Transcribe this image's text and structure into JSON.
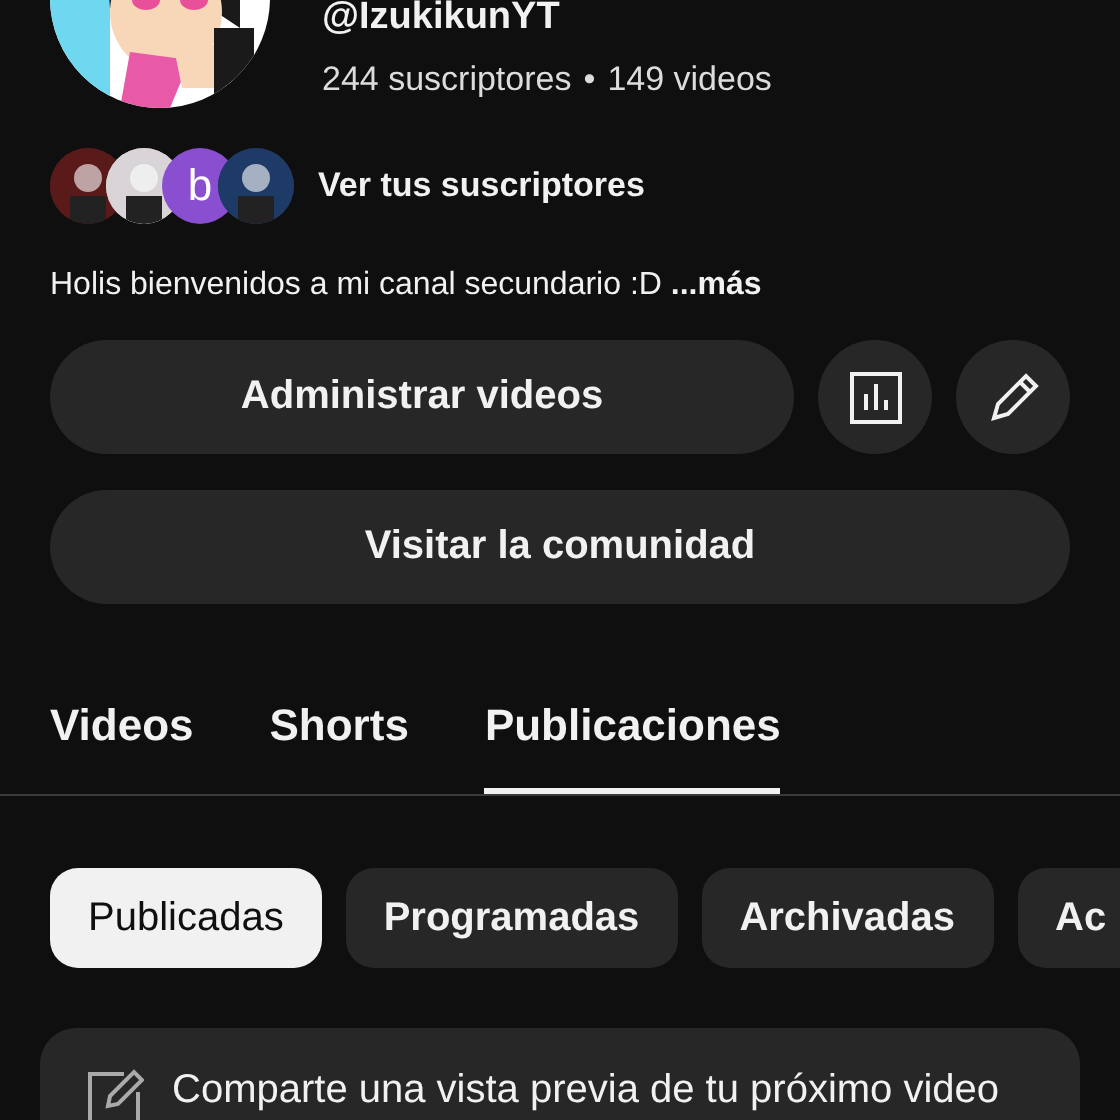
{
  "channel": {
    "handle": "@IzukikunYT",
    "stats": [
      "244 suscriptores",
      "149 videos"
    ],
    "separator": "•",
    "avatar": {
      "kind": "picture"
    }
  },
  "subscribers": {
    "avatars": [
      {
        "kind": "picture",
        "color": "#5a1a1a"
      },
      {
        "kind": "picture",
        "color": "#d8d4d8"
      },
      {
        "kind": "letter",
        "letter": "b",
        "color": "#8a4fd0"
      },
      {
        "kind": "picture",
        "color": "#1e3a66"
      }
    ],
    "link": "Ver tus suscriptores"
  },
  "description": {
    "text": "Holis bienvenidos a mi canal secundario :D",
    "more": "...más"
  },
  "buttons": {
    "manage": "Administrar videos",
    "community": "Visitar la comunidad"
  },
  "tabs": [
    {
      "label": "Videos",
      "selected": false
    },
    {
      "label": "Shorts",
      "selected": false
    },
    {
      "label": "Publicaciones",
      "selected": true
    }
  ],
  "chips": [
    {
      "label": "Publicadas",
      "selected": true
    },
    {
      "label": "Programadas",
      "selected": false
    },
    {
      "label": "Archivadas",
      "selected": false
    },
    {
      "label": "Ac",
      "selected": false
    }
  ],
  "composer": {
    "prompt": "Comparte una vista previa de tu próximo video"
  }
}
